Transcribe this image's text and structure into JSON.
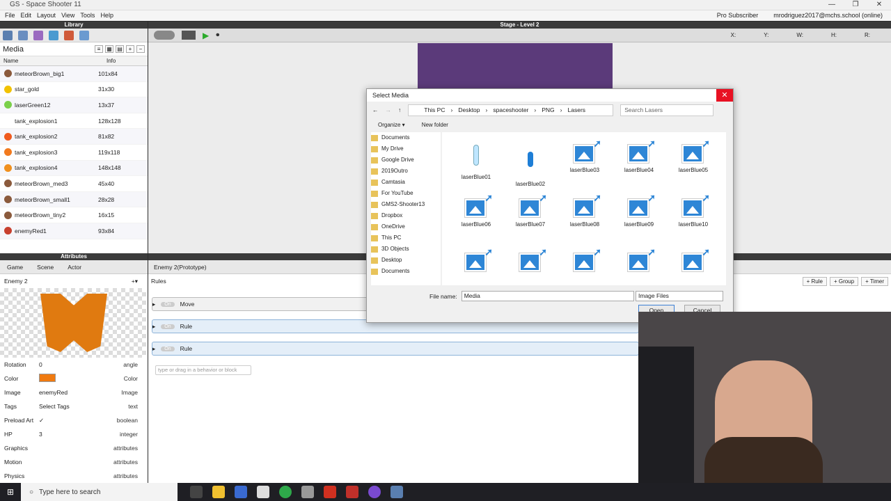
{
  "window": {
    "title": "GS - Space Shooter 11",
    "controls": [
      "—",
      "❐",
      "✕"
    ]
  },
  "menu": {
    "items": [
      "File",
      "Edit",
      "Layout",
      "View",
      "Tools",
      "Help"
    ],
    "pro": "Pro Subscriber",
    "account": "mrodriguez2017@mchs.school (online)"
  },
  "library": {
    "header": "Library",
    "title": "Media",
    "col_name": "Name",
    "col_info": "Info",
    "items": [
      {
        "name": "meteorBrown_big1",
        "info": "101x84",
        "color": "#8b5a3c"
      },
      {
        "name": "star_gold",
        "info": "31x30",
        "color": "#f2c200"
      },
      {
        "name": "laserGreen12",
        "info": "13x37",
        "color": "#7bd04a"
      },
      {
        "name": "tank_explosion1",
        "info": "128x128",
        "color": "#ffffff"
      },
      {
        "name": "tank_explosion2",
        "info": "81x82",
        "color": "#f05a1e"
      },
      {
        "name": "tank_explosion3",
        "info": "119x118",
        "color": "#f27a1e"
      },
      {
        "name": "tank_explosion4",
        "info": "148x148",
        "color": "#f0901e"
      },
      {
        "name": "meteorBrown_med3",
        "info": "45x40",
        "color": "#8b5a3c"
      },
      {
        "name": "meteorBrown_small1",
        "info": "28x28",
        "color": "#8b5a3c"
      },
      {
        "name": "meteorBrown_tiny2",
        "info": "16x15",
        "color": "#8b5a3c"
      },
      {
        "name": "enemyRed1",
        "info": "93x84",
        "color": "#c8402e"
      }
    ]
  },
  "stage": {
    "header": "Stage - Level 2",
    "coords": [
      "X:",
      "Y:",
      "W:",
      "H:",
      "R:"
    ]
  },
  "attributes": {
    "header": "Attributes",
    "tabs": [
      "Game",
      "Scene",
      "Actor"
    ],
    "actor_name": "Enemy 2",
    "rows": [
      {
        "k": "Rotation",
        "v": "0",
        "t": "angle"
      },
      {
        "k": "Color",
        "v": "",
        "t": "Color"
      },
      {
        "k": "Image",
        "v": "enemyRed",
        "t": "Image"
      },
      {
        "k": "Tags",
        "v": "Select Tags",
        "t": "text"
      },
      {
        "k": "Preload Art",
        "v": "✓",
        "t": "boolean"
      },
      {
        "k": "HP",
        "v": "3",
        "t": "integer"
      },
      {
        "k": "Graphics",
        "v": "",
        "t": "attributes"
      },
      {
        "k": "Motion",
        "v": "",
        "t": "attributes"
      },
      {
        "k": "Physics",
        "v": "",
        "t": "attributes"
      }
    ]
  },
  "rules": {
    "tab": "Enemy 2(Prototype)",
    "label": "Rules",
    "buttons": [
      "+ Rule",
      "+ Group",
      "+ Timer"
    ],
    "items": [
      {
        "on": "On",
        "name": "Move"
      },
      {
        "on": "On",
        "name": "Rule"
      },
      {
        "on": "On",
        "name": "Rule"
      }
    ],
    "placeholder": "type or drag in a behavior or block"
  },
  "dialog": {
    "title": "Select Media",
    "path": [
      "This PC",
      "Desktop",
      "spaceshooter",
      "PNG",
      "Lasers"
    ],
    "search": "Search Lasers",
    "organize": "Organize ▾",
    "newfolder": "New folder",
    "nav": [
      "Documents",
      "My Drive",
      "Google Drive",
      "2019Outro",
      "Camtasia",
      "For YouTube",
      "GMS2-Shooter13",
      "Dropbox",
      "OneDrive",
      "This PC",
      "3D Objects",
      "Desktop",
      "Documents"
    ],
    "files": [
      "laserBlue01",
      "laserBlue02",
      "laserBlue03",
      "laserBlue04",
      "laserBlue05",
      "laserBlue06",
      "laserBlue07",
      "laserBlue08",
      "laserBlue09",
      "laserBlue10",
      "",
      "",
      "",
      "",
      ""
    ],
    "filename_label": "File name:",
    "filename": "Media",
    "filetype": "Image Files",
    "open": "Open",
    "cancel": "Cancel"
  },
  "taskbar": {
    "search": "Type here to search"
  }
}
